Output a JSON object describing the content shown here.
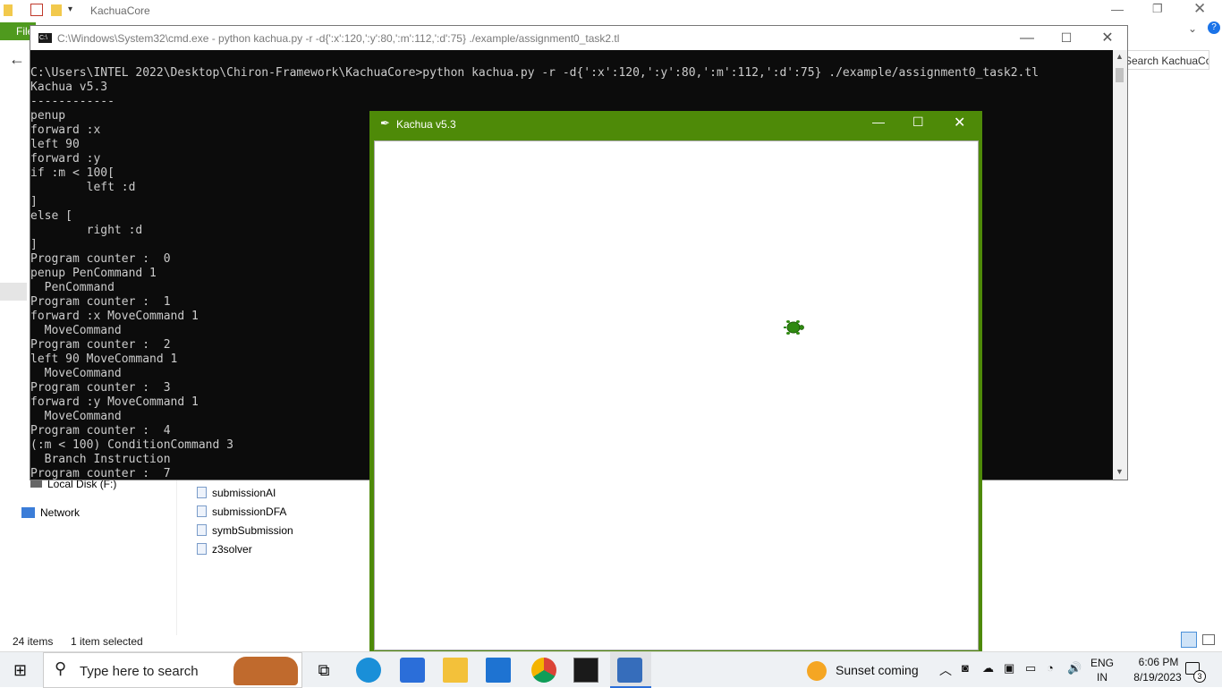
{
  "explorer": {
    "title": "KachuaCore",
    "file_tab": "File",
    "search_placeholder": "Search KachuaCore",
    "nav": {
      "local_disk": "Local Disk (F:)",
      "network": "Network"
    },
    "files": [
      "submissionAI",
      "submissionDFA",
      "symbSubmission",
      "z3solver"
    ],
    "status": {
      "items_count": "24 items",
      "selected": "1 item selected"
    }
  },
  "cmd": {
    "title": "C:\\Windows\\System32\\cmd.exe - python  kachua.py -r -d{':x':120,':y':80,':m':112,':d':75} ./example/assignment0_task2.tl",
    "lines": [
      "C:\\Users\\INTEL 2022\\Desktop\\Chiron-Framework\\KachuaCore>python kachua.py -r -d{':x':120,':y':80,':m':112,':d':75} ./example/assignment0_task2.tl",
      "Kachua v5.3",
      "------------",
      "penup",
      "forward :x",
      "left 90",
      "forward :y",
      "if :m < 100[",
      "        left :d",
      "]",
      "else [",
      "        right :d",
      "]",
      "Program counter :  0",
      "penup PenCommand 1",
      "  PenCommand",
      "Program counter :  1",
      "forward :x MoveCommand 1",
      "  MoveCommand",
      "Program counter :  2",
      "left 90 MoveCommand 1",
      "  MoveCommand",
      "Program counter :  3",
      "forward :y MoveCommand 1",
      "  MoveCommand",
      "Program counter :  4",
      "(:m < 100) ConditionCommand 3",
      "  Branch Instruction",
      "Program counter :  7"
    ]
  },
  "kachua": {
    "title": "Kachua v5.3",
    "turtle_icon": "turtle-icon",
    "frame_color": "#4e8a08"
  },
  "taskbar": {
    "search_placeholder": "Type here to search",
    "weather": "Sunset coming",
    "lang": "ENG",
    "region": "IN",
    "time": "6:06 PM",
    "date": "8/19/2023",
    "notifications": "3"
  }
}
